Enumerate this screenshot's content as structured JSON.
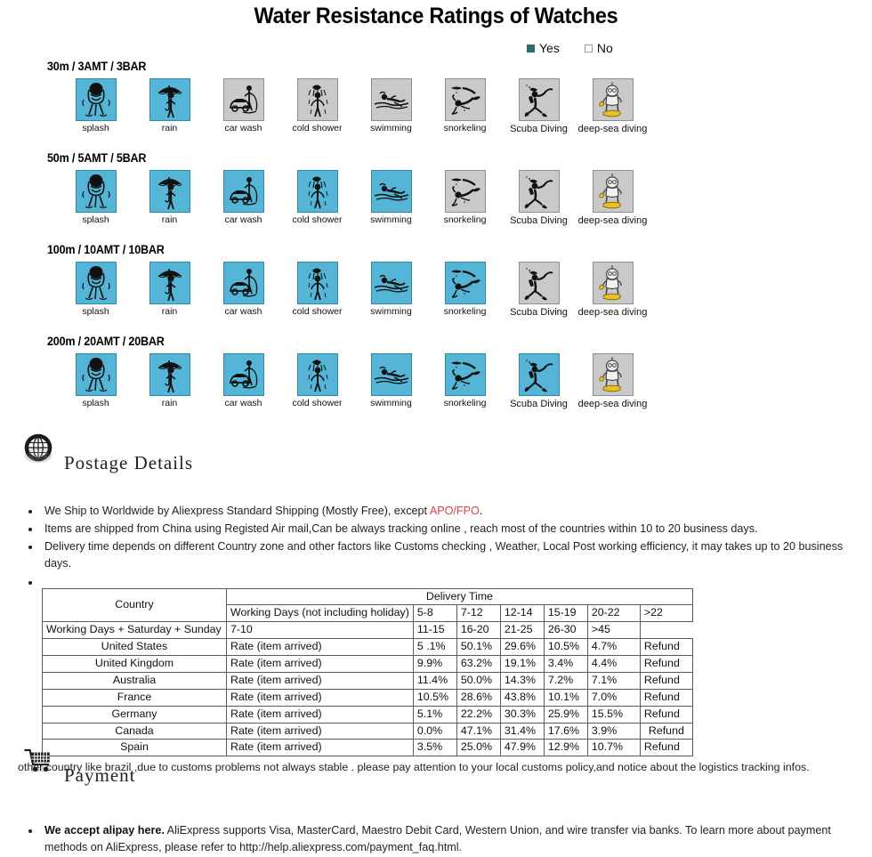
{
  "title": "Water Resistance Ratings of Watches",
  "legend": {
    "yes_label": "Yes",
    "no_label": "No",
    "yes_color": "#2e6e6a",
    "no_color": "#ffffff"
  },
  "activities": [
    {
      "key": "splash",
      "label": "splash",
      "icon": "splash-icon"
    },
    {
      "key": "rain",
      "label": "rain",
      "icon": "rain-umbrella-icon"
    },
    {
      "key": "car_wash",
      "label": "car wash",
      "icon": "car-wash-icon"
    },
    {
      "key": "cold_shower",
      "label": "cold shower",
      "icon": "cold-shower-icon"
    },
    {
      "key": "swimming",
      "label": "swimming",
      "icon": "swimming-icon"
    },
    {
      "key": "snorkeling",
      "label": "snorkeling",
      "icon": "snorkeling-icon"
    },
    {
      "key": "scuba_diving",
      "label": "Scuba Diving",
      "icon": "scuba-diving-icon"
    },
    {
      "key": "deep_sea_diving",
      "label": "deep-sea diving",
      "icon": "deep-sea-diving-icon"
    }
  ],
  "ratings": [
    {
      "label": "30m / 3AMT / 3BAR",
      "values": [
        "yes",
        "yes",
        "no",
        "no",
        "no",
        "no",
        "no",
        "no"
      ]
    },
    {
      "label": "50m / 5AMT / 5BAR",
      "values": [
        "yes",
        "yes",
        "yes",
        "yes",
        "yes",
        "no",
        "no",
        "no"
      ]
    },
    {
      "label": "100m / 10AMT / 10BAR",
      "values": [
        "yes",
        "yes",
        "yes",
        "yes",
        "yes",
        "yes",
        "no",
        "no"
      ]
    },
    {
      "label": "200m / 20AMT / 20BAR",
      "values": [
        "yes",
        "yes",
        "yes",
        "yes",
        "yes",
        "yes",
        "yes",
        "no"
      ]
    }
  ],
  "tile_colors": {
    "yes": "#54b5d6",
    "no": "#c9c9c9"
  },
  "postage": {
    "heading": "Postage  Details",
    "icon": "globe-icon",
    "bullets": [
      {
        "parts": [
          {
            "text": "We Ship to Worldwide by Aliexpress Standard Shipping (Mostly Free), except ",
            "style": "normal"
          },
          {
            "text": "APO/FPO",
            "style": "red"
          },
          {
            "text": ".",
            "style": "normal"
          }
        ]
      },
      {
        "parts": [
          {
            "text": "Items are shipped from China using Registed Air mail,Can be always tracking online , reach most of the countries within 10 to 20 business days.",
            "style": "normal"
          }
        ]
      },
      {
        "parts": [
          {
            "text": "Delivery time depends on different Country zone and other factors like Customs checking , Weather, Local Post working efficiency, it may takes up to 20 business days.",
            "style": "normal"
          }
        ]
      },
      {
        "parts": []
      }
    ]
  },
  "delivery_table": {
    "country_header": "Country",
    "delivery_time_header": "Delivery Time",
    "row_headers": [
      "Working Days (not including holiday)",
      "Working Days + Saturday + Sunday"
    ],
    "ranges_weekdays": [
      "5-8",
      "7-12",
      "12-14",
      "15-19",
      "20-22",
      ">22"
    ],
    "ranges_alldays": [
      "7-10",
      "11-15",
      "16-20",
      "21-25",
      "26-30",
      ">45"
    ],
    "rate_label": "Rate (item arrived)",
    "rows": [
      {
        "country": "United States",
        "values": [
          "5 .1%",
          "50.1%",
          "29.6%",
          "10.5%",
          "4.7%",
          "Refund"
        ],
        "refund_centered": false
      },
      {
        "country": "United Kingdom",
        "values": [
          "9.9%",
          "63.2%",
          "19.1%",
          "3.4%",
          "4.4%",
          "Refund"
        ],
        "refund_centered": false
      },
      {
        "country": "Australia",
        "values": [
          "11.4%",
          "50.0%",
          "14.3%",
          "7.2%",
          "7.1%",
          "Refund"
        ],
        "refund_centered": false
      },
      {
        "country": "France",
        "values": [
          "10.5%",
          "28.6%",
          "43.8%",
          "10.1%",
          "7.0%",
          "Refund"
        ],
        "refund_centered": false
      },
      {
        "country": "Germany",
        "values": [
          "5.1%",
          "22.2%",
          "30.3%",
          "25.9%",
          "15.5%",
          "Refund"
        ],
        "refund_centered": false
      },
      {
        "country": "Canada",
        "values": [
          "0.0%",
          "47.1%",
          "31.4%",
          "17.6%",
          "3.9%",
          "Refund"
        ],
        "refund_centered": true
      },
      {
        "country": "Spain",
        "values": [
          "3.5%",
          "25.0%",
          "47.9%",
          "12.9%",
          "10.7%",
          "Refund"
        ],
        "refund_centered": false
      }
    ],
    "note": "other country like brazil ,due to customs problems not always stable .  please pay attention to your local customs policy,and notice about the logistics tracking infos."
  },
  "payment": {
    "heading": "Payment",
    "icon": "shopping-cart-icon",
    "bullets": [
      {
        "parts": [
          {
            "text": "We accept alipay here.",
            "style": "bold"
          },
          {
            "text": " AliExpress supports Visa, MasterCard, Maestro Debit Card, Western Union, and wire transfer via banks. To learn more about payment methods on AliExpress, please refer to http://help.aliexpress.com/payment_faq.html.",
            "style": "normal"
          }
        ]
      }
    ]
  }
}
